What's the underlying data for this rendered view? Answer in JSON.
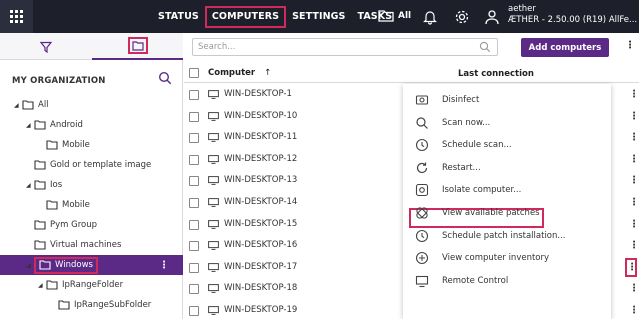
{
  "topbar": {
    "nav": [
      "STATUS",
      "COMPUTERS",
      "SETTINGS",
      "TASKS"
    ],
    "active_nav": "COMPUTERS",
    "all_label": "All",
    "user_name": "aether",
    "user_version": "ÆTHER - 2.50.00 (R19) AllFe..."
  },
  "left": {
    "org_title": "MY ORGANIZATION",
    "tree": [
      {
        "label": "All",
        "level": 0,
        "caret": true
      },
      {
        "label": "Android",
        "level": 1,
        "caret": true
      },
      {
        "label": "Mobile",
        "level": 2,
        "caret": false
      },
      {
        "label": "Gold or template image",
        "level": 1,
        "caret": false
      },
      {
        "label": "Ios",
        "level": 1,
        "caret": true
      },
      {
        "label": "Mobile",
        "level": 2,
        "caret": false
      },
      {
        "label": "Pym Group",
        "level": 1,
        "caret": false
      },
      {
        "label": "Virtual machines",
        "level": 1,
        "caret": false
      },
      {
        "label": "Windows",
        "level": 1,
        "caret": true,
        "selected": true
      },
      {
        "label": "IpRangeFolder",
        "level": 2,
        "caret": true
      },
      {
        "label": "IpRangeSubFolder",
        "level": 3,
        "caret": false
      }
    ]
  },
  "main": {
    "search_placeholder": "Search...",
    "add_button": "Add computers",
    "col_computer": "Computer",
    "col_last": "Last connection",
    "rows": [
      "WIN-DESKTOP-1",
      "WIN-DESKTOP-10",
      "WIN-DESKTOP-11",
      "WIN-DESKTOP-12",
      "WIN-DESKTOP-13",
      "WIN-DESKTOP-14",
      "WIN-DESKTOP-15",
      "WIN-DESKTOP-16",
      "WIN-DESKTOP-17",
      "WIN-DESKTOP-18",
      "WIN-DESKTOP-19"
    ]
  },
  "context_menu": {
    "items": [
      {
        "label": "Disinfect",
        "icon": "disinfect-icon"
      },
      {
        "label": "Scan now...",
        "icon": "search-icon"
      },
      {
        "label": "Schedule scan...",
        "icon": "clock-icon"
      },
      {
        "label": "Restart...",
        "icon": "restart-icon"
      },
      {
        "label": "Isolate computer...",
        "icon": "isolate-icon"
      },
      {
        "label": "View available patches",
        "icon": "patch-icon"
      },
      {
        "label": "Schedule patch installation...",
        "icon": "clock-icon"
      },
      {
        "label": "View computer inventory",
        "icon": "inventory-icon"
      },
      {
        "label": "Remote Control",
        "icon": "remote-control-icon"
      }
    ],
    "highlighted": "View available patches"
  },
  "colors": {
    "topbar_bg": "#1d1f2a",
    "accent_purple": "#5b2a86",
    "highlight_red": "#d02a5c"
  }
}
